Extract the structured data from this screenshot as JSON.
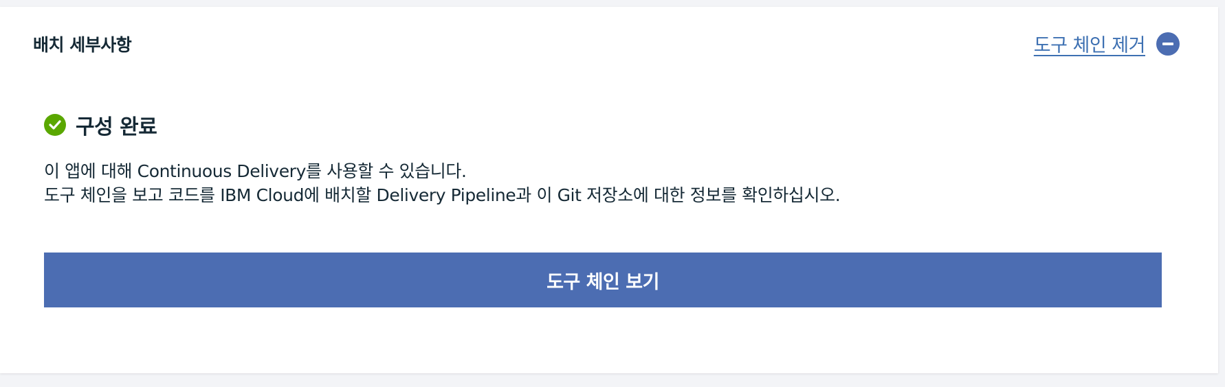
{
  "card": {
    "title": "배치 세부사항",
    "remove_toolchain_label": "도구 체인 제거",
    "remove_icon": "minus-circle-icon"
  },
  "status": {
    "icon": "checkmark-circle-icon",
    "title": "구성 완료"
  },
  "description": {
    "line1": "이 앱에 대해 Continuous Delivery를 사용할 수 있습니다.",
    "line2": "도구 체인을 보고 코드를 IBM Cloud에 배치할 Delivery Pipeline과 이 Git 저장소에 대한 정보를 확인하십시오."
  },
  "actions": {
    "view_toolchain_label": "도구 체인 보기"
  },
  "colors": {
    "primary": "#4c6db2",
    "link": "#3d70b2",
    "success": "#5aa700",
    "text": "#152935",
    "background": "#f3f4f7"
  }
}
